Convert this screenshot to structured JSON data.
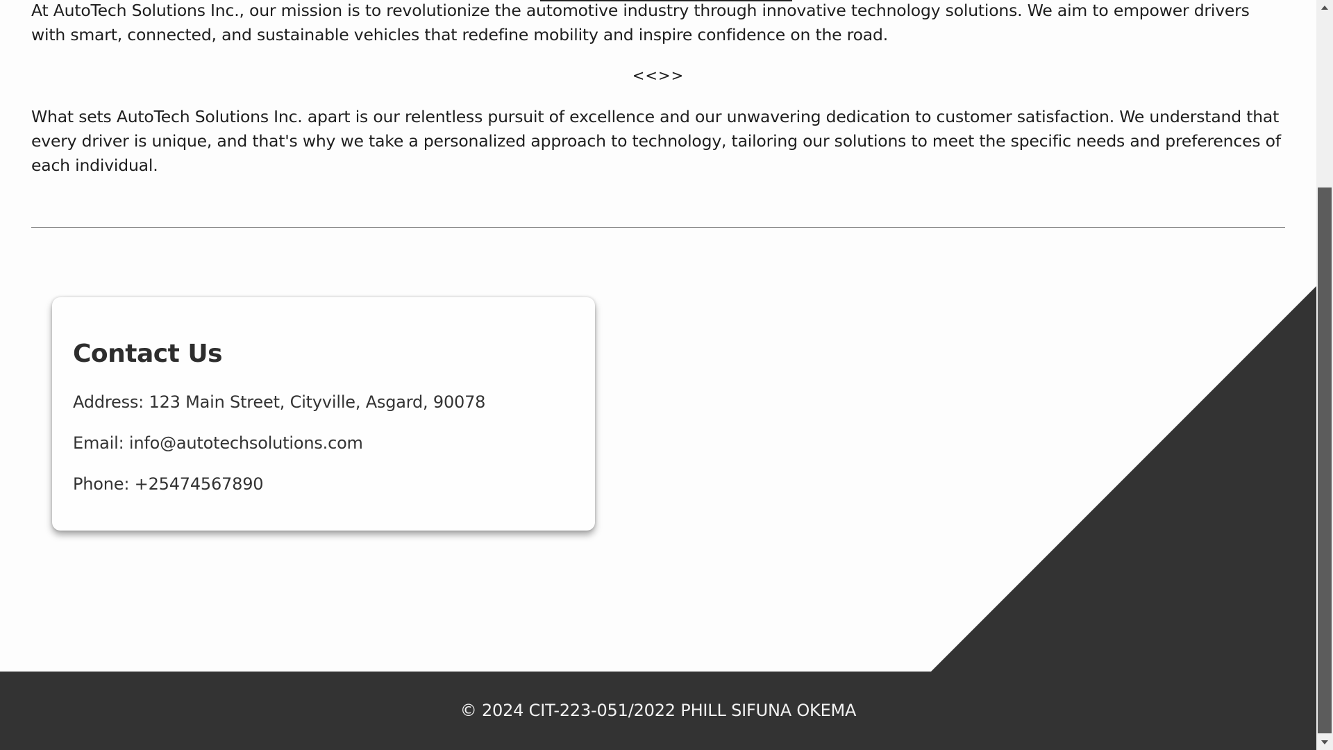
{
  "about": {
    "mission_paragraph": "At AutoTech Solutions Inc., our mission is to revolutionize the automotive industry through innovative technology solutions. We aim to empower drivers with smart, connected, and sustainable vehicles that redefine mobility and inspire confidence on the road.",
    "separator_glyphs": "<<>>",
    "difference_paragraph": "What sets AutoTech Solutions Inc. apart is our relentless pursuit of excellence and our unwavering dedication to customer satisfaction. We understand that every driver is unique, and that's why we take a personalized approach to technology, tailoring our solutions to meet the specific needs and preferences of each individual."
  },
  "contact": {
    "title": "Contact Us",
    "address": "Address: 123 Main Street, Cityville, Asgard, 90078",
    "email": "Email: info@autotechsolutions.com",
    "phone": "Phone: +25474567890"
  },
  "footer": {
    "text": "© 2024  CIT-223-051/2022 PHILL SIFUNA OKEMA"
  },
  "colors": {
    "page_background": "#fdfdfd",
    "dark_accent": "#333333",
    "footer_text": "#f2f2f2",
    "body_text": "#1e1e1e"
  },
  "icons": {
    "scroll_up": "triangle-up-icon",
    "scroll_down": "triangle-down-icon"
  }
}
